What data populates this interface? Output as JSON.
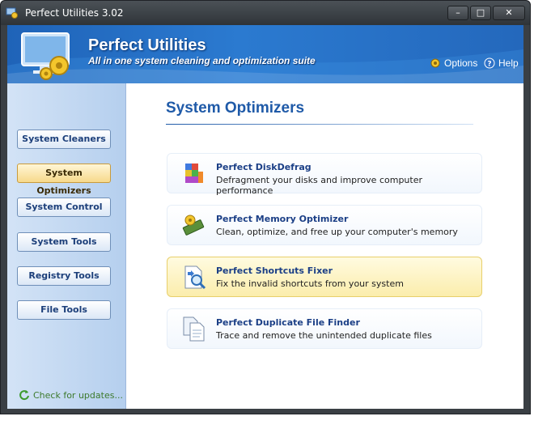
{
  "window": {
    "title": "Perfect Utilities 3.02",
    "controls": {
      "minimize": "–",
      "maximize": "□",
      "close": "✕"
    }
  },
  "banner": {
    "title": "Perfect Utilities",
    "subtitle": "All in one system cleaning and optimization suite",
    "options_label": "Options",
    "help_label": "Help"
  },
  "sidebar": {
    "items": [
      {
        "label": "System Cleaners",
        "active": false
      },
      {
        "label": "System Optimizers",
        "active": true
      },
      {
        "label": "System Control",
        "active": false
      },
      {
        "label": "System Tools",
        "active": false
      },
      {
        "label": "Registry Tools",
        "active": false
      },
      {
        "label": "File Tools",
        "active": false
      }
    ],
    "update_label": "Check for updates..."
  },
  "main": {
    "section_title": "System Optimizers",
    "tools": [
      {
        "name": "Perfect DiskDefrag",
        "description": "Defragment your disks and improve computer performance",
        "icon": "disk-defrag-icon",
        "active": false
      },
      {
        "name": "Perfect Memory Optimizer",
        "description": "Clean, optimize, and free up your computer's memory",
        "icon": "memory-optimizer-icon",
        "active": false
      },
      {
        "name": "Perfect Shortcuts Fixer",
        "description": "Fix the invalid shortcuts from your system",
        "icon": "shortcuts-fixer-icon",
        "active": true
      },
      {
        "name": "Perfect Duplicate File Finder",
        "description": "Trace and remove the unintended duplicate files",
        "icon": "duplicate-finder-icon",
        "active": false
      }
    ]
  },
  "colors": {
    "banner": "#2b7ad0",
    "section_title": "#1f5aa8",
    "active_highlight": "#f7d98b",
    "update_link": "#3d7a2d"
  }
}
